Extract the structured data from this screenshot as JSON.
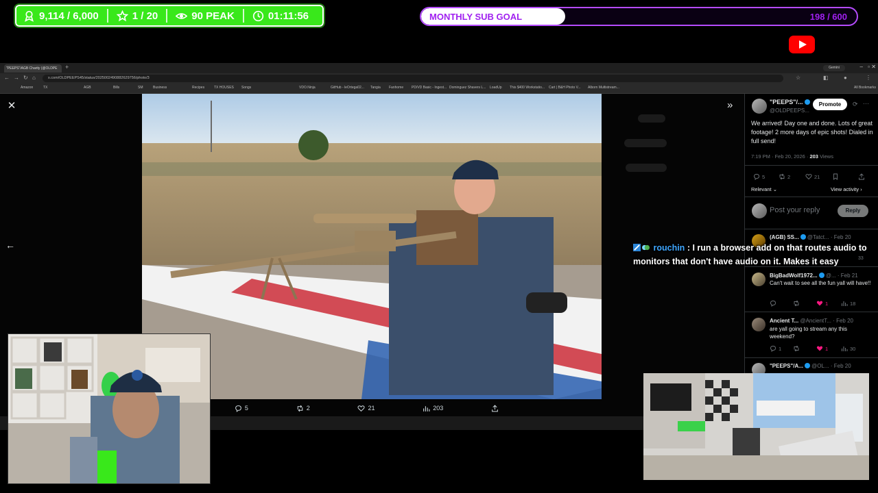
{
  "overlay": {
    "followers": "9,114 / 6,000",
    "subs": "1 / 20",
    "viewers": "90 PEAK",
    "uptime": "01:11:56",
    "sub_goal_label": "MONTHLY SUB GOAL",
    "sub_goal_count": "198 / 600",
    "sub_goal_fraction": 0.33,
    "colors": {
      "stats_bg": "#39e81b",
      "goal_accent": "#a020f0"
    }
  },
  "browser": {
    "tab_title": "\"PEEPS\"/AGB Charity (@OLDPE",
    "gemini": "Gemini",
    "url": "x.com/OLDPEEPS45/status/2025002490882629756/photo/3",
    "bookmarks": [
      "Amazon",
      "TX",
      "AGB",
      "Bills",
      "Business",
      "Recipes",
      "TX HOUSES",
      "Songs",
      "SM",
      "VDO.Ninja",
      "GitHub - leOrtega02...",
      "Tangia",
      "Fanhome",
      "PD/VD Basic - Ingest...",
      "Dominguez Shavers L...",
      "LoadUp",
      "This $400 Workstatio...",
      "Cart | B&H Photo V...",
      "Alborn Multistream..."
    ],
    "all_bookmarks": "All Bookmarks"
  },
  "viewer": {
    "replies": "5",
    "reposts": "2",
    "likes": "21",
    "views": "203"
  },
  "tweet": {
    "author": "\"PEEPS\"/...",
    "handle": "@OLDPEEPS...",
    "promote": "Promote",
    "text": "We arrived! Day one and done. Lots of great footage! 2 more days of epic shots! Dialed in full send!",
    "time": "7:19 PM · Feb 20, 2026 · ",
    "views_count": "203",
    "views_label": " Views",
    "replies": "5",
    "reposts": "2",
    "likes": "21",
    "relevant": "Relevant",
    "view_activity": "View activity",
    "reply_placeholder": "Post your reply",
    "reply_button": "Reply"
  },
  "replies": [
    {
      "name": "(AGB) SS...",
      "handle": "@Tatct...",
      "date": "Feb 20",
      "text": "",
      "likes": "",
      "views": "33"
    },
    {
      "name": "BigBadWolf1972...",
      "handle": "@...",
      "date": "Feb 21",
      "text": "Can't wait to see all the fun yall will have!!",
      "likes": "1",
      "views": "18"
    },
    {
      "name": "Ancient T...",
      "handle": "@AncientT...",
      "date": "Feb 20",
      "text": "are yall going to stream any this weekend?",
      "reply_count": "1",
      "likes": "1",
      "views": "30"
    },
    {
      "name": "\"PEEPS\"/A...",
      "handle": "@OL...",
      "date": "Feb 20",
      "text": "",
      "likes": "",
      "views": ""
    }
  ],
  "chat": {
    "user": "rouchin",
    "message": "I run a browser add on that routes audio to monitors that don't have audio on it. Makes it easy"
  }
}
